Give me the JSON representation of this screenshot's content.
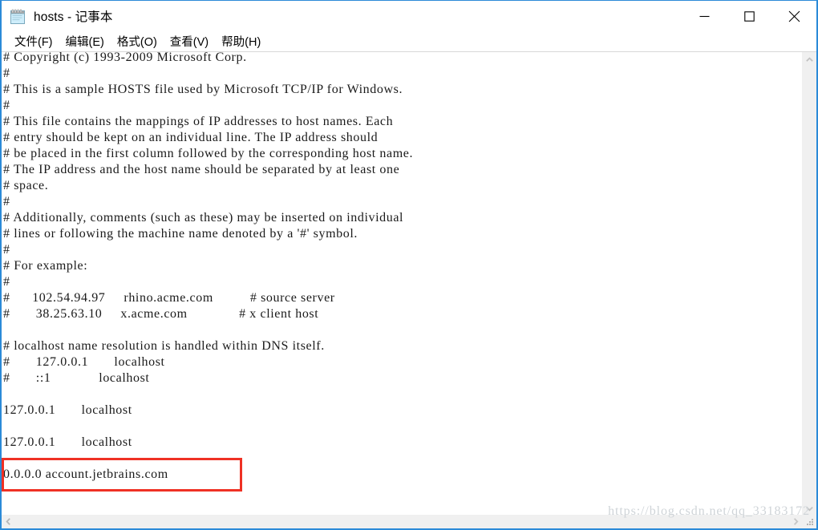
{
  "window": {
    "title": "hosts - 记事本",
    "icon": "notepad-icon",
    "border_color": "#2b8ad8",
    "controls": {
      "minimize_label": "—",
      "maximize_label": "□",
      "close_label": "✕"
    }
  },
  "menubar": {
    "items": [
      {
        "label": "文件(F)"
      },
      {
        "label": "编辑(E)"
      },
      {
        "label": "格式(O)"
      },
      {
        "label": "查看(V)"
      },
      {
        "label": "帮助(H)"
      }
    ]
  },
  "editor": {
    "lines": [
      "# Copyright (c) 1993-2009 Microsoft Corp.",
      "#",
      "# This is a sample HOSTS file used by Microsoft TCP/IP for Windows.",
      "#",
      "# This file contains the mappings of IP addresses to host names. Each",
      "# entry should be kept on an individual line. The IP address should",
      "# be placed in the first column followed by the corresponding host name.",
      "# The IP address and the host name should be separated by at least one",
      "# space.",
      "#",
      "# Additionally, comments (such as these) may be inserted on individual",
      "# lines or following the machine name denoted by a '#' symbol.",
      "#",
      "# For example:",
      "#",
      "#      102.54.94.97     rhino.acme.com          # source server",
      "#       38.25.63.10     x.acme.com              # x client host",
      "",
      "# localhost name resolution is handled within DNS itself.",
      "#       127.0.0.1       localhost",
      "#       ::1             localhost",
      "",
      "127.0.0.1       localhost",
      "",
      "127.0.0.1       localhost",
      "",
      "0.0.0.0 account.jetbrains.com",
      ""
    ]
  },
  "scrollbars": {
    "vertical": {
      "up_arrow": "chevron-up-icon",
      "down_arrow": "chevron-down-icon"
    },
    "horizontal": {
      "left_arrow": "chevron-left-icon",
      "right_arrow": "chevron-right-icon"
    }
  },
  "annotation": {
    "color": "#ef3124",
    "target_line": "0.0.0.0 account.jetbrains.com"
  },
  "watermark": {
    "text": "https://blog.csdn.net/qq_33183172"
  }
}
